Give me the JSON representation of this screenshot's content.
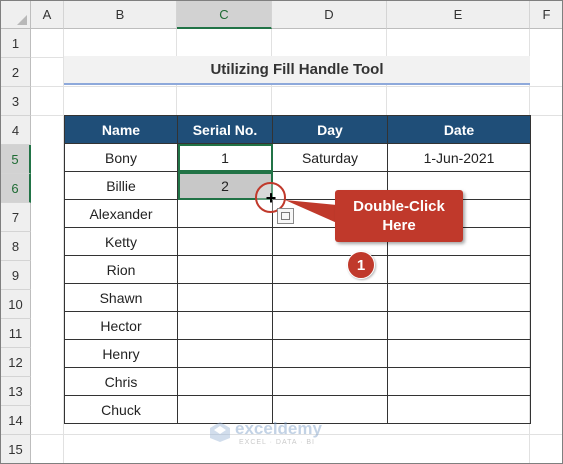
{
  "columns": [
    "A",
    "B",
    "C",
    "D",
    "E",
    "F"
  ],
  "rows": [
    "1",
    "2",
    "3",
    "4",
    "5",
    "6",
    "7",
    "8",
    "9",
    "10",
    "11",
    "12",
    "13",
    "14",
    "15"
  ],
  "title": "Utilizing Fill Handle Tool",
  "table": {
    "headers": [
      "Name",
      "Serial No.",
      "Day",
      "Date"
    ],
    "rows": [
      [
        "Bony",
        "1",
        "Saturday",
        "1-Jun-2021"
      ],
      [
        "Billie",
        "2",
        "",
        ""
      ],
      [
        "Alexander",
        "",
        "",
        ""
      ],
      [
        "Ketty",
        "",
        "",
        ""
      ],
      [
        "Rion",
        "",
        "",
        ""
      ],
      [
        "Shawn",
        "",
        "",
        ""
      ],
      [
        "Hector",
        "",
        "",
        ""
      ],
      [
        "Henry",
        "",
        "",
        ""
      ],
      [
        "Chris",
        "",
        "",
        ""
      ],
      [
        "Chuck",
        "",
        "",
        ""
      ]
    ]
  },
  "callout": {
    "line1": "Double-Click",
    "line2": "Here"
  },
  "step_badge": "1",
  "watermark": {
    "name": "exceldemy",
    "tagline": "EXCEL · DATA · BI"
  },
  "colors": {
    "header_fill": "#1f4e78",
    "selection_green": "#217346",
    "callout_red": "#c0392b",
    "title_underline": "#8ea9db"
  }
}
